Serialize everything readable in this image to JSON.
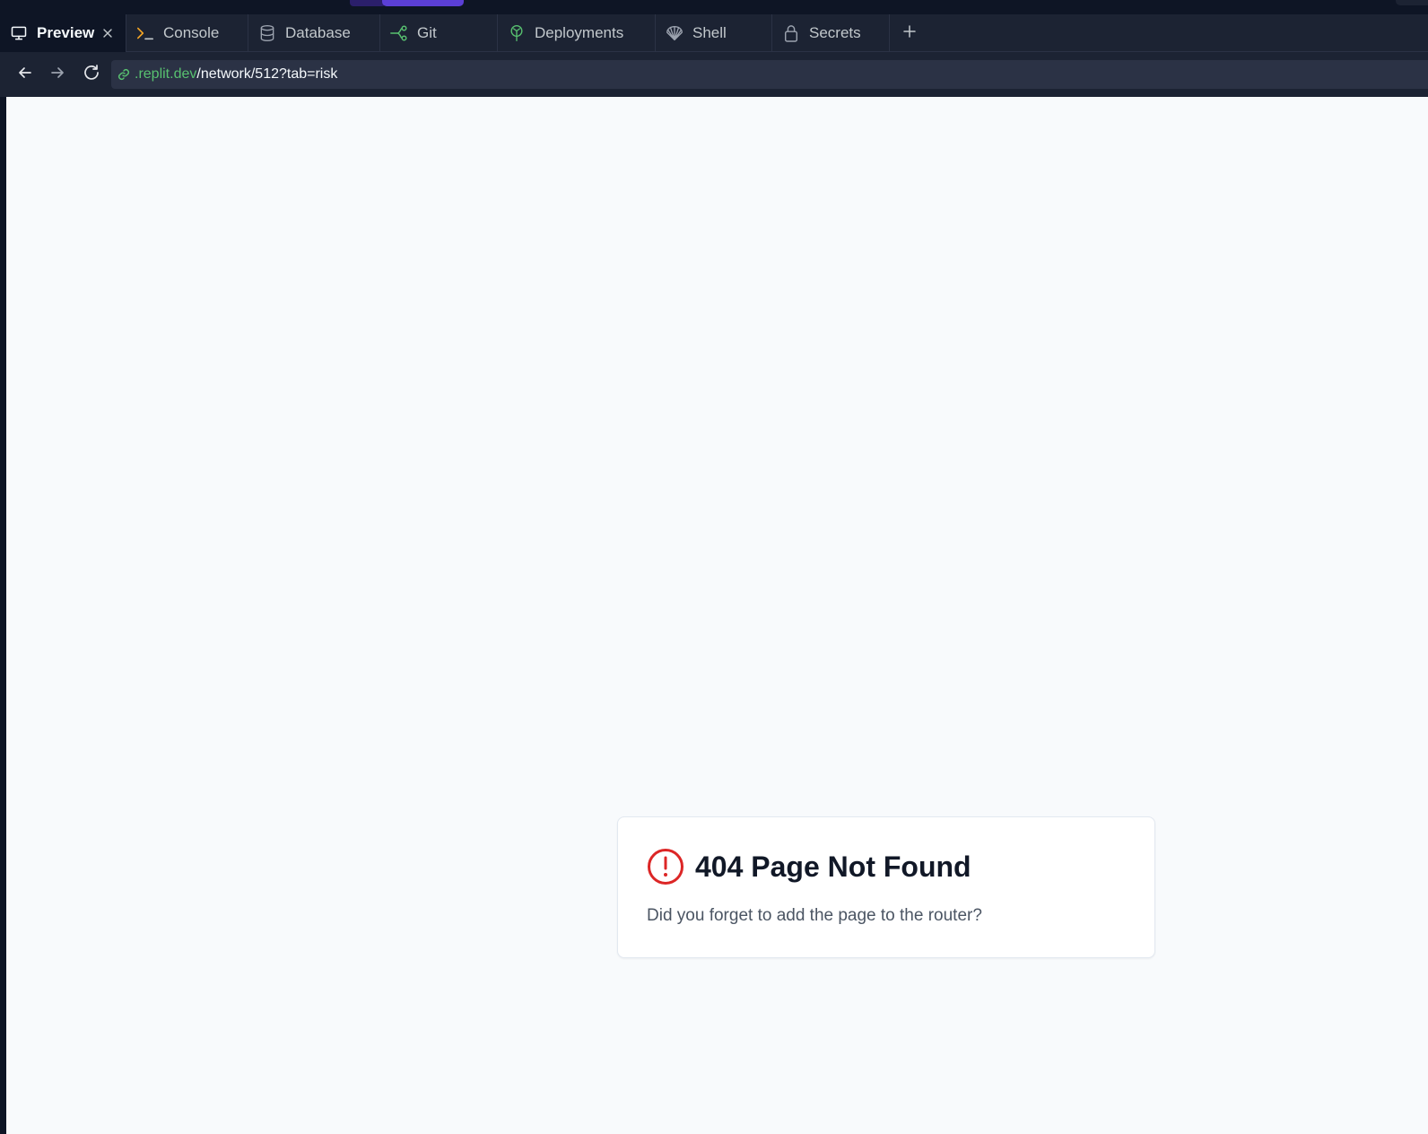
{
  "tabs": [
    {
      "label": "Preview",
      "icon": "monitor-icon",
      "active": true
    },
    {
      "label": "Console",
      "icon": "terminal-icon"
    },
    {
      "label": "Database",
      "icon": "database-icon"
    },
    {
      "label": "Git",
      "icon": "git-branch-icon"
    },
    {
      "label": "Deployments",
      "icon": "deployments-icon"
    },
    {
      "label": "Shell",
      "icon": "shell-icon"
    },
    {
      "label": "Secrets",
      "icon": "lock-icon"
    }
  ],
  "url": {
    "host": ".replit.dev",
    "path": "/network/512?tab=risk"
  },
  "error": {
    "title": "404 Page Not Found",
    "message": "Did you forget to add the page to the router?"
  },
  "colors": {
    "accent": "#5b3fd6",
    "error": "#dc2626",
    "url_host": "#58c170"
  }
}
